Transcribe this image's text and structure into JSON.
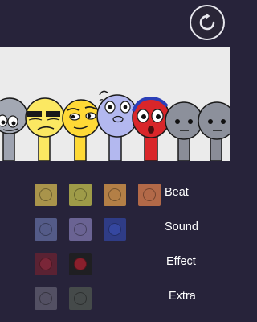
{
  "colors": {
    "background": "#27233a",
    "stage": "#ebebeb",
    "beat_slots": [
      "#a9944b",
      "#9e9b48",
      "#b37f46",
      "#b26948"
    ],
    "sound_slots": [
      "#545b88",
      "#6a6393",
      "#2f3c86"
    ],
    "effect_slots": [
      "#5a2233",
      "#1f1f22"
    ],
    "extra_slots": [
      "#535063",
      "#454a4a"
    ],
    "label": "#ffffff"
  },
  "controls": {
    "reset_icon": "reset-icon"
  },
  "rows": [
    {
      "label": "Beat",
      "slot_count": 4
    },
    {
      "label": "Sound",
      "slot_count": 3
    },
    {
      "label": "Effect",
      "slot_count": 2
    },
    {
      "label": "Extra",
      "slot_count": 2
    }
  ],
  "characters": [
    {
      "name": "gray-character",
      "body": "#9ea3b0"
    },
    {
      "name": "yellow-character-1",
      "body": "#fbe862"
    },
    {
      "name": "yellow-character-2",
      "body": "#ffd936"
    },
    {
      "name": "lavender-character",
      "body": "#b3b8ef"
    },
    {
      "name": "red-character",
      "body": "#d9262a"
    },
    {
      "name": "gray-character-2",
      "body": "#8a8d98"
    },
    {
      "name": "gray-character-3",
      "body": "#8a8d98"
    }
  ]
}
